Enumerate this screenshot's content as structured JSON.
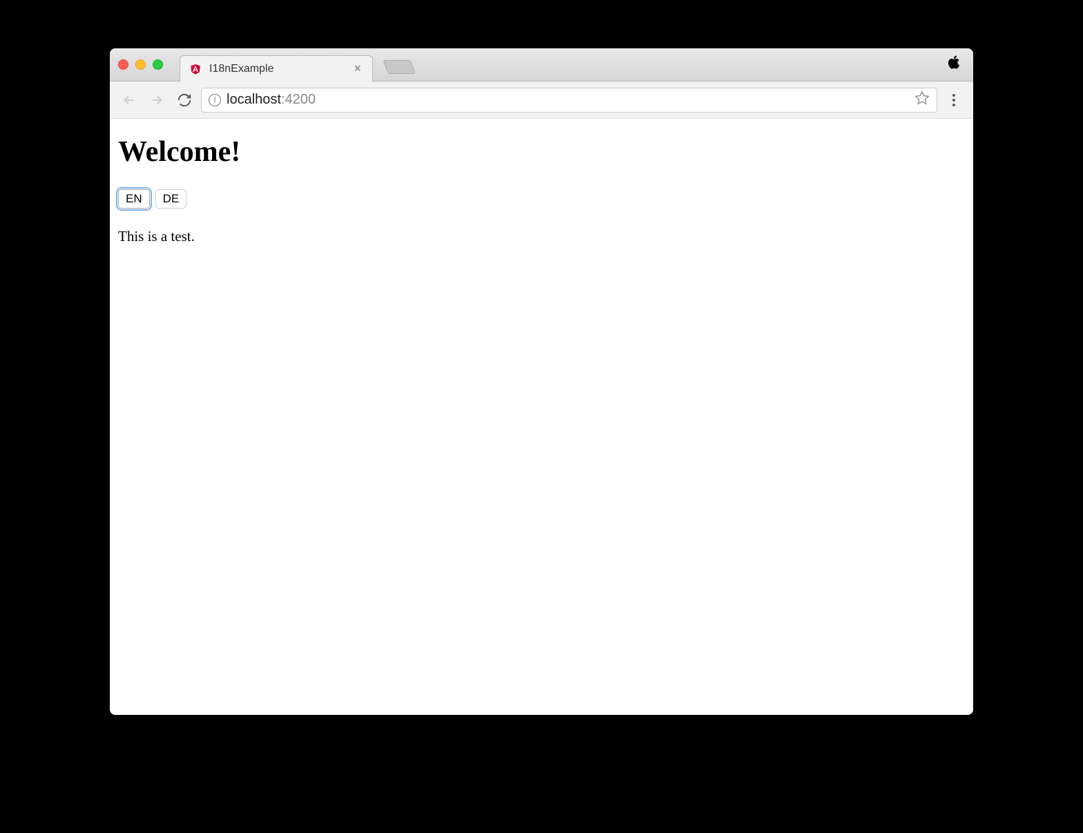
{
  "browser": {
    "tab_title": "I18nExample",
    "url_host": "localhost",
    "url_port": ":4200"
  },
  "page": {
    "heading": "Welcome!",
    "lang_btn_en": "EN",
    "lang_btn_de": "DE",
    "body_text": "This is a test."
  }
}
